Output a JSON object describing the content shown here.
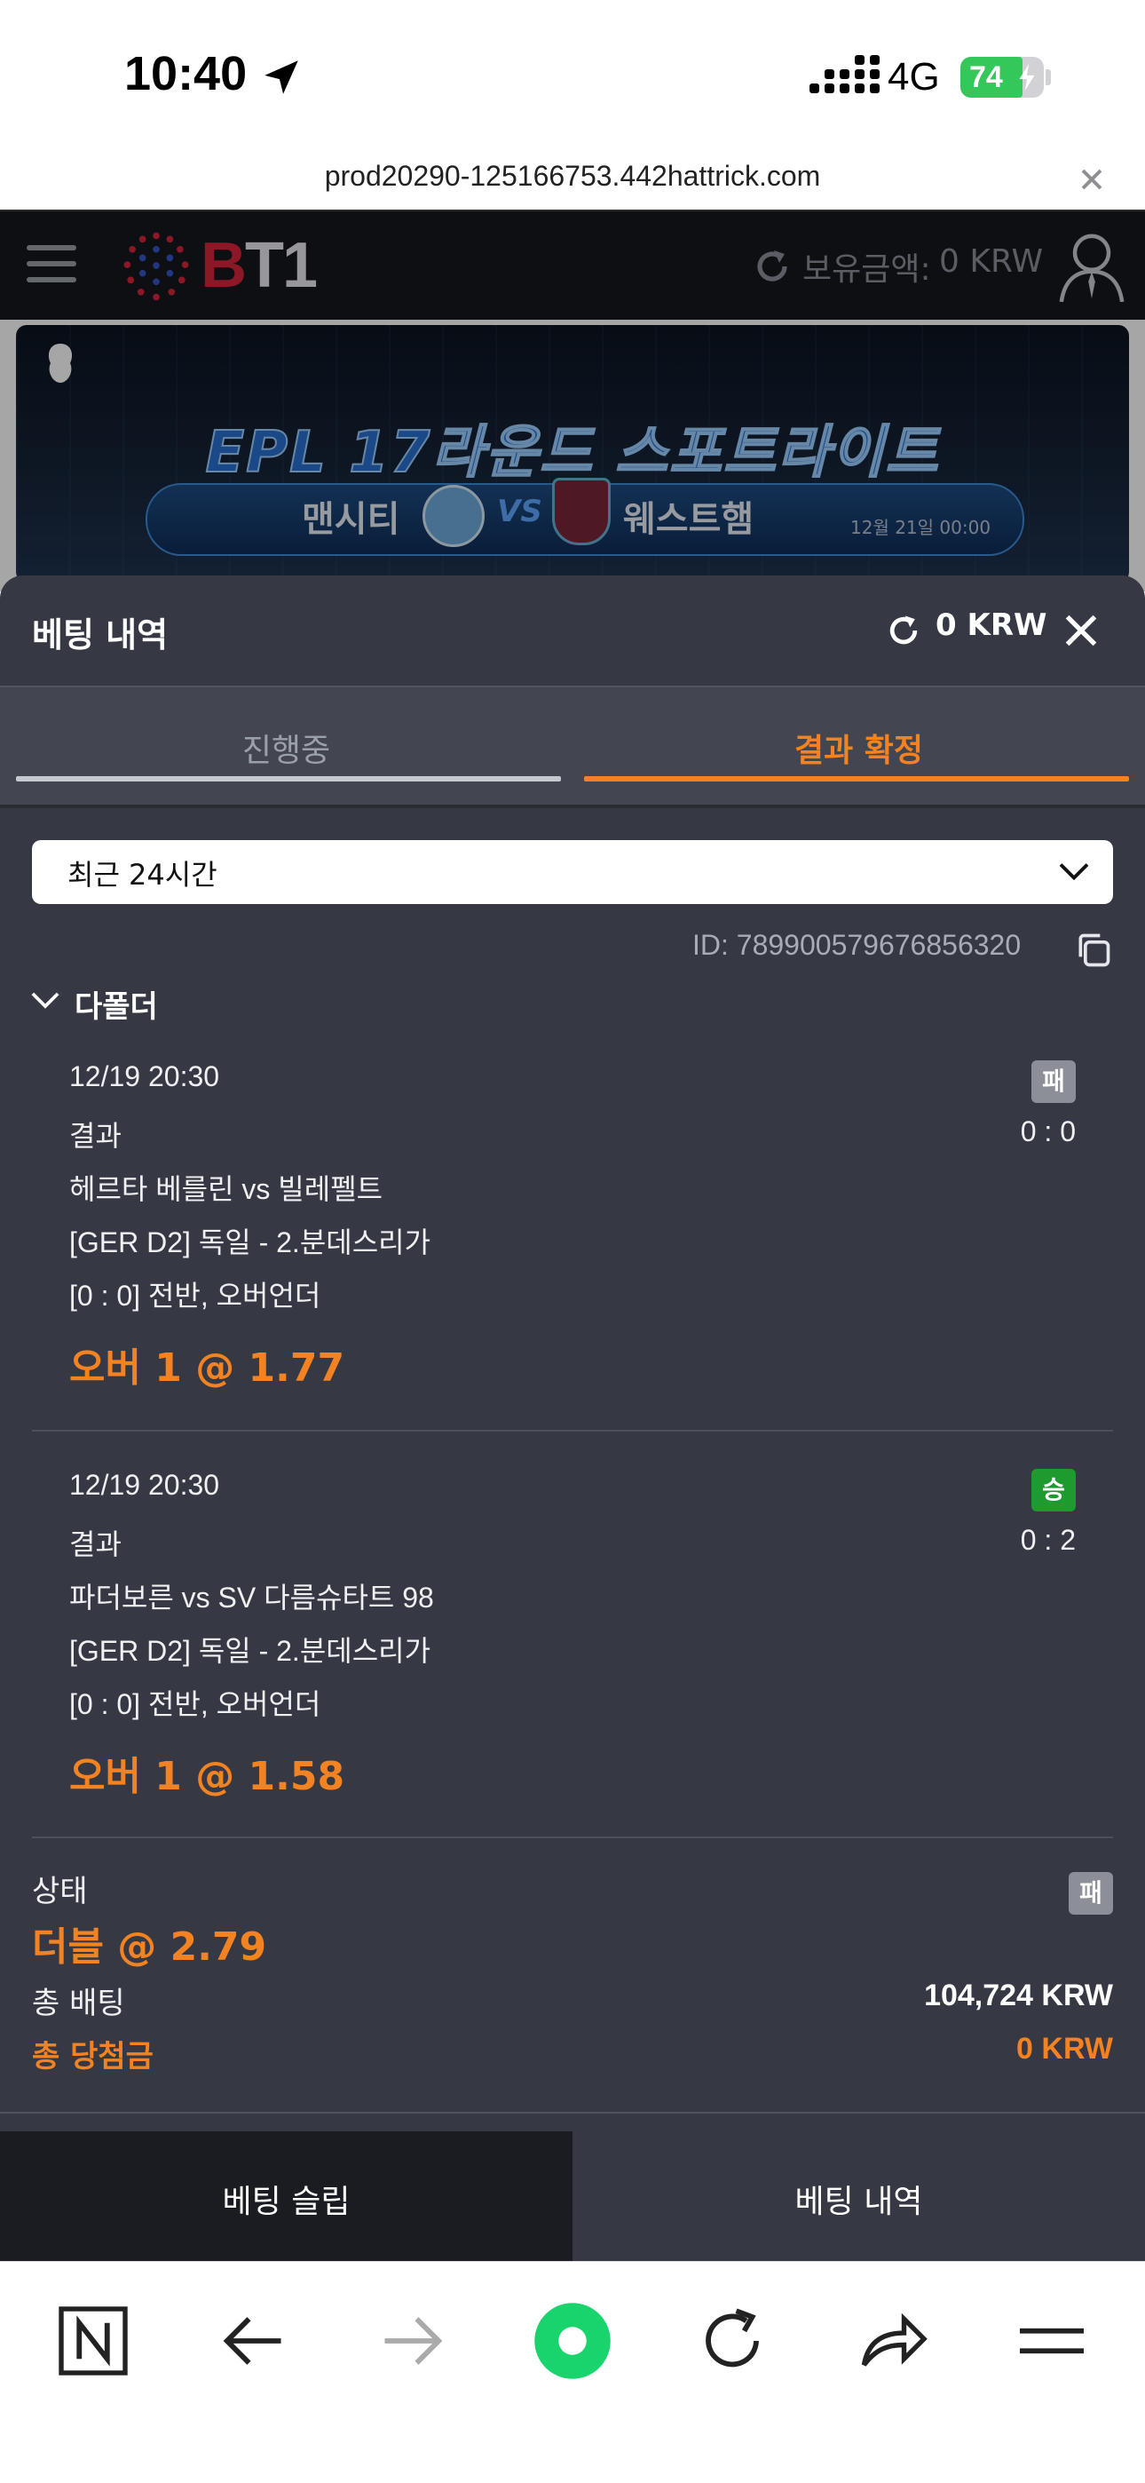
{
  "status_bar": {
    "time": "10:40",
    "network": "4G",
    "battery": "74",
    "battery_level": 0.74
  },
  "browser": {
    "url": "prod20290-125166753.442hattrick.com"
  },
  "site_header": {
    "logo": "BT1",
    "balance_label": "보유금액:",
    "balance_value": "0 KRW"
  },
  "banner": {
    "title": "EPL 17라운드 스포트라이트",
    "team_home": "맨시티",
    "vs": "VS",
    "team_away": "웨스트햄",
    "date": "12월 21일 00:00"
  },
  "bet_sheet": {
    "title": "베팅 내역",
    "balance": "0 KRW",
    "tabs": [
      {
        "label": "진행중",
        "active": false
      },
      {
        "label": "결과 확정",
        "active": true
      }
    ],
    "period_select": "최근 24시간",
    "bet_id": "ID: 789900579676856320",
    "group_label": "다폴더",
    "selections": [
      {
        "datetime": "12/19 20:30",
        "market": "결과",
        "score": "0 : 0",
        "match": "헤르타 베를린 vs 빌레펠트",
        "league": "[GER D2] 독일 - 2.분데스리가",
        "detail": "[0 : 0] 전반, 오버언더",
        "pick": "오버 1 @ 1.77",
        "result": "패"
      },
      {
        "datetime": "12/19 20:30",
        "market": "결과",
        "score": "0 : 2",
        "match": "파더보른 vs SV 다름슈타트 98",
        "league": "[GER D2] 독일 - 2.분데스리가",
        "detail": "[0 : 0] 전반, 오버언더",
        "pick": "오버 1 @ 1.58",
        "result": "승"
      }
    ],
    "summary": {
      "status_label": "상태",
      "status_badge": "패",
      "bet_type": "더블 @ 2.79",
      "total_bet_label": "총 배팅",
      "total_bet_value": "104,724 KRW",
      "total_win_label": "총 당첨금",
      "total_win_value": "0 KRW"
    }
  },
  "bottom_tabs": {
    "slip": "베팅 슬립",
    "history": "베팅 내역"
  },
  "colors": {
    "accent": "#f28222",
    "win": "#1f9a2e",
    "lose": "#8c8f97",
    "sheet_bg": "#363944"
  }
}
